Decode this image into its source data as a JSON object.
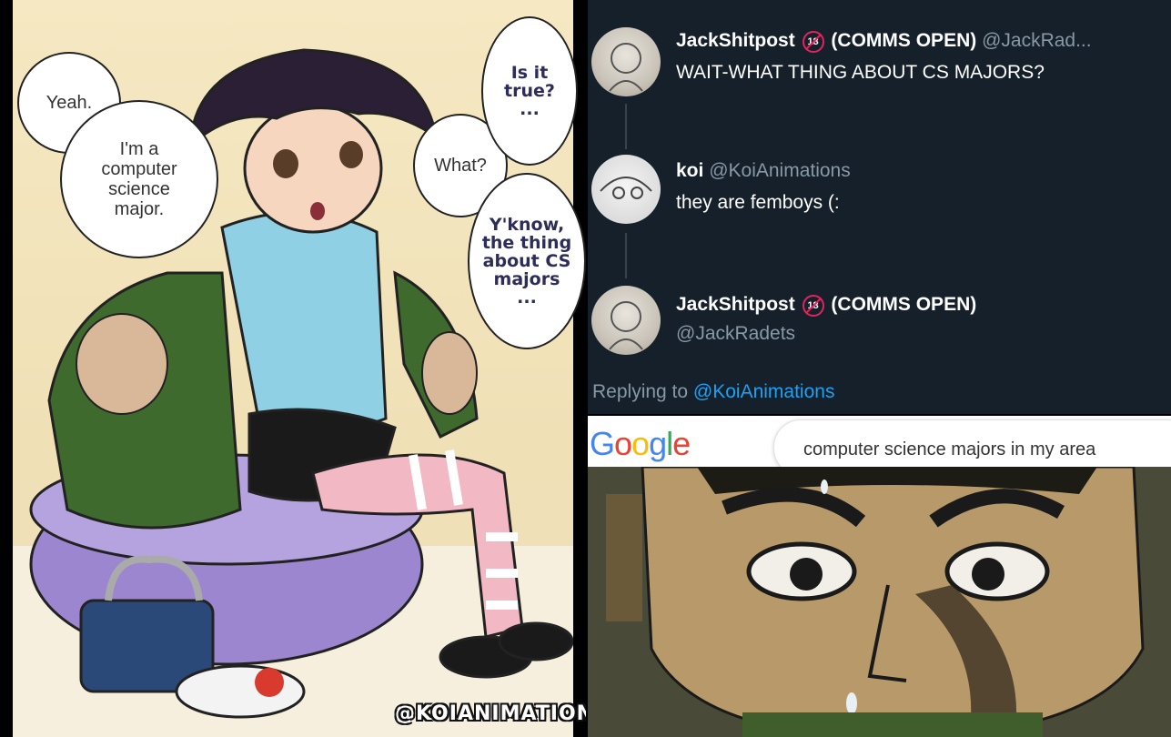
{
  "comic": {
    "bubbles": {
      "yeah": "Yeah.",
      "cs_major": "I'm a\ncomputer\nscience\nmajor.",
      "what": "What?",
      "is_it_true": "Is it\ntrue?\n...",
      "yknow": "Y'know,\nthe thing\nabout CS\nmajors\n..."
    },
    "watermark": "@KOIANIMATIONS"
  },
  "tweets": [
    {
      "name": "JackShitpost",
      "badge": "18",
      "suffix": "(COMMS OPEN)",
      "handle": "@JackRad...",
      "text": "WAIT-WHAT THING ABOUT CS MAJORS?"
    },
    {
      "name": "koi",
      "handle": "@KoiAnimations",
      "text": "they are femboys (:"
    },
    {
      "name": "JackShitpost",
      "badge": "18",
      "suffix": "(COMMS OPEN)",
      "handle": "@JackRadets"
    }
  ],
  "replying": {
    "prefix": "Replying to",
    "target": "@KoiAnimations"
  },
  "google": {
    "logo": [
      "G",
      "o",
      "o",
      "g",
      "l",
      "e"
    ],
    "logo_colors": [
      "#4285f4",
      "#ea4335",
      "#fbbc05",
      "#4285f4",
      "#34a853",
      "#ea4335"
    ],
    "query": "computer science majors in my area"
  },
  "colors": {
    "twitter_bg": "#15202b",
    "twitter_link": "#1da1f2",
    "badge_red": "#e0245e"
  }
}
